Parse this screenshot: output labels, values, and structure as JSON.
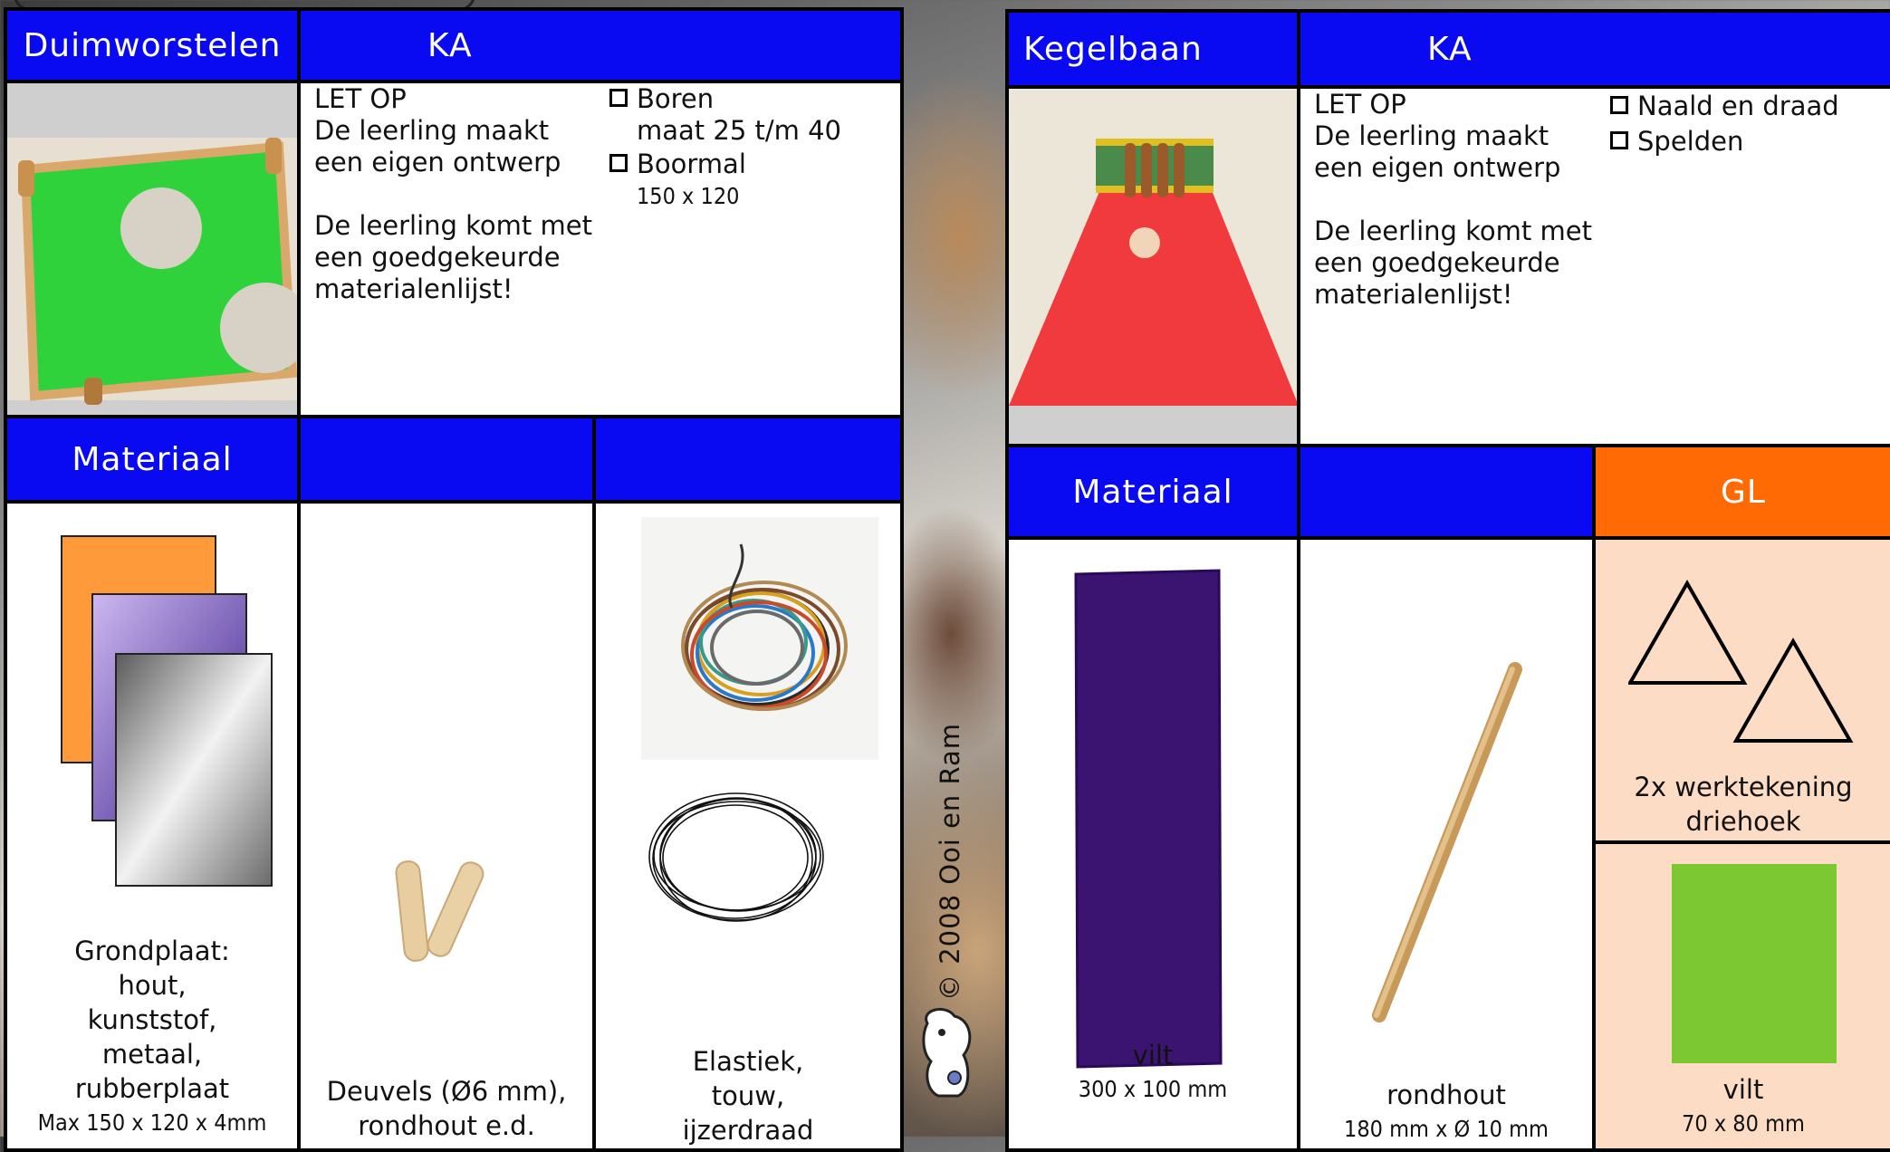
{
  "left_card": {
    "title": "Duimworstelen",
    "badge": "KA",
    "note_heading": "LET OP",
    "note_line1": "De leerling maakt",
    "note_line2": "een eigen ontwerp",
    "note_line3": "De leerling komt met",
    "note_line4": "een goedgekeurde",
    "note_line5": "materialenlijst!",
    "tools": [
      {
        "label": "Boren",
        "detail": "maat 25 t/m 40"
      },
      {
        "label": "Boormal",
        "detail": "150 x 120"
      }
    ],
    "materials_header": "Materiaal",
    "materials": [
      {
        "lines": [
          "Grondplaat:",
          "hout,",
          "kunststof,",
          "metaal,",
          "rubberplaat"
        ],
        "size": "Max 150 x 120 x 4mm"
      },
      {
        "lines": [
          "Deuvels (Ø6 mm),",
          "rondhout e.d."
        ]
      },
      {
        "lines": [
          "Elastiek,",
          "touw,",
          "ijzerdraad"
        ]
      }
    ]
  },
  "right_card": {
    "title": "Kegelbaan",
    "badge": "KA",
    "note_heading": "LET OP",
    "note_line1": "De leerling maakt",
    "note_line2": "een eigen ontwerp",
    "note_line3": "De leerling komt met",
    "note_line4": "een goedgekeurde",
    "note_line5": "materialenlijst!",
    "tools": [
      {
        "label": "Naald en draad"
      },
      {
        "label": "Spelden"
      }
    ],
    "materials_header": "Materiaal",
    "gl_label": "GL",
    "materials": [
      {
        "name": "vilt",
        "size": "300 x 100 mm"
      },
      {
        "name": "rondhout",
        "size": "180 mm x Ø 10 mm"
      },
      {
        "name": "vilt",
        "size": "70 x 80 mm"
      }
    ],
    "drawing_note_line1": "2x werktekening",
    "drawing_note_line2": "driehoek"
  },
  "copyright": "© 2008 Ooi en Ram",
  "colors": {
    "blue": "#0a0af2",
    "orange": "#ff6a05",
    "peach": "#fddcc5",
    "felt_purple": "#3a1470",
    "felt_green": "#7cc832"
  }
}
